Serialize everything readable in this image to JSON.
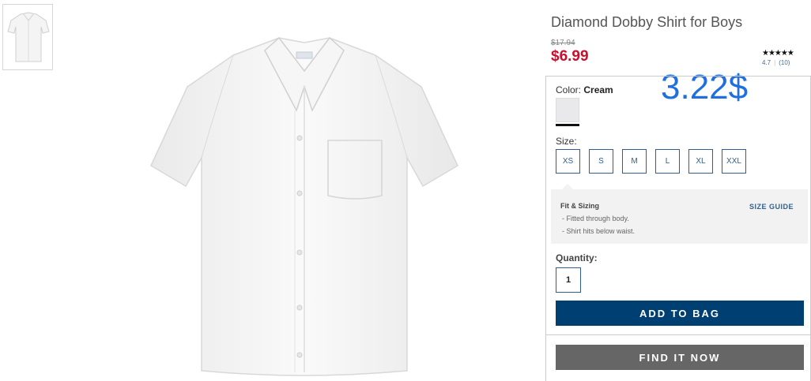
{
  "product": {
    "title": "Diamond Dobby Shirt for Boys",
    "old_price": "$17.94",
    "price": "$6.99",
    "rating_stars": "★★★★★",
    "rating_value": "4.7",
    "rating_count": "(10)"
  },
  "overlay_price": "3.22$",
  "color": {
    "label": "Color:",
    "value": "Cream",
    "swatch": "#e9e9ec"
  },
  "size": {
    "label": "Size:",
    "options": [
      "XS",
      "S",
      "M",
      "L",
      "XL",
      "XXL"
    ]
  },
  "fit": {
    "title": "Fit & Sizing",
    "lines": [
      "- Fitted through body.",
      "- Shirt hits below waist."
    ],
    "guide_link": "SIZE GUIDE"
  },
  "quantity": {
    "label": "Quantity:",
    "value": "1"
  },
  "buttons": {
    "add_to_bag": "ADD TO BAG",
    "find_it_now": "FIND IT NOW"
  },
  "colors": {
    "price_red": "#c8102e",
    "primary_blue": "#003f72",
    "find_gray": "#666666",
    "overlay_blue": "#1f6fe0"
  },
  "images": {
    "thumbnail": "shirt-thumbnail",
    "main": "white-short-sleeve-shirt"
  }
}
